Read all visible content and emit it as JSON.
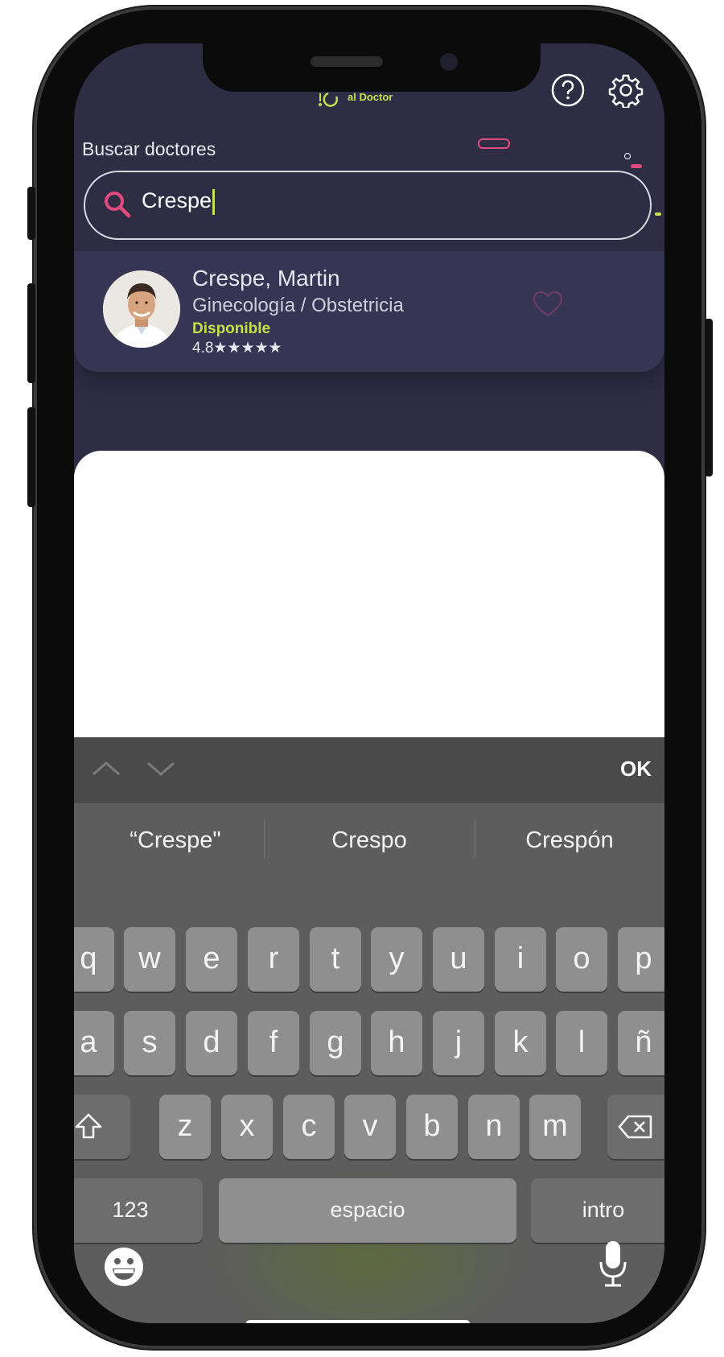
{
  "header": {
    "logo_text": "al Doctor"
  },
  "search": {
    "label": "Buscar doctores",
    "value": "Crespe"
  },
  "results": [
    {
      "name": "Crespe, Martin",
      "specialty": "Ginecología / Obstetricia",
      "status": "Disponible",
      "rating_value": "4.8",
      "stars": "★★★★★"
    }
  ],
  "keyboard": {
    "ok_label": "OK",
    "suggestions": [
      "“Crespe\"",
      "Crespo",
      "Crespón"
    ],
    "row1": [
      "q",
      "w",
      "e",
      "r",
      "t",
      "y",
      "u",
      "i",
      "o",
      "p"
    ],
    "row2": [
      "a",
      "s",
      "d",
      "f",
      "g",
      "h",
      "j",
      "k",
      "l",
      "ñ"
    ],
    "row3": [
      "z",
      "x",
      "c",
      "v",
      "b",
      "n",
      "m"
    ],
    "numbers_label": "123",
    "space_label": "espacio",
    "return_label": "intro"
  },
  "colors": {
    "background": "#2e2d44",
    "accent_green": "#c6e04b",
    "accent_pink": "#e04a7c",
    "keyboard": "#5d5d5d"
  }
}
